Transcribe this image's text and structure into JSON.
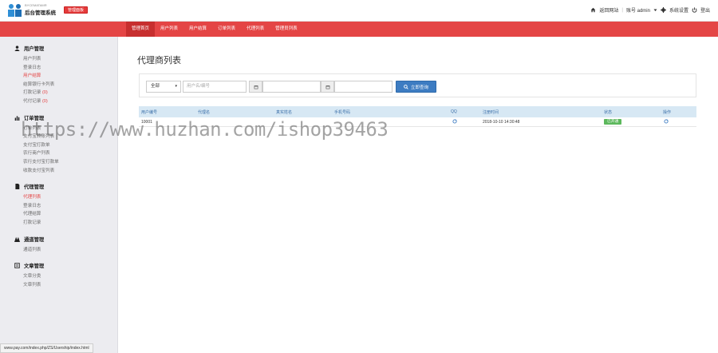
{
  "header": {
    "logo_small": "BYCEMATAMR",
    "logo_title": "后台管理系统",
    "badge": "管理面板",
    "home_link": "返回网站",
    "account_label": "账号 admin",
    "settings_label": "系统设置",
    "logout_label": "登出"
  },
  "nav": {
    "items": [
      {
        "label": "管理首页",
        "active": true
      },
      {
        "label": "用户列表",
        "active": false
      },
      {
        "label": "用户结算",
        "active": false
      },
      {
        "label": "订单列表",
        "active": false
      },
      {
        "label": "代理列表",
        "active": false
      },
      {
        "label": "管理员列表",
        "active": false
      }
    ]
  },
  "sidebar": {
    "groups": [
      {
        "icon": "user-icon",
        "title": "用户管理",
        "items": [
          {
            "label": "用户列表"
          },
          {
            "label": "登录日志"
          },
          {
            "label": "用户结算",
            "active": true
          },
          {
            "label": "结算银行卡列表"
          },
          {
            "label": "打款记录 ",
            "count": "(0)"
          },
          {
            "label": "代付记录 ",
            "count": "(0)"
          }
        ]
      },
      {
        "icon": "chart-icon",
        "title": "订单管理",
        "items": [
          {
            "label": "订单列表"
          },
          {
            "label": "支付宝转账列表"
          },
          {
            "label": "支付宝打款单"
          },
          {
            "label": "农行商户列表"
          },
          {
            "label": "农行支付宝打款单"
          },
          {
            "label": "收款支付宝列表"
          }
        ]
      },
      {
        "icon": "file-icon",
        "title": "代理管理",
        "items": [
          {
            "label": "代理列表",
            "active": true
          },
          {
            "label": "登录日志"
          },
          {
            "label": "代理结算"
          },
          {
            "label": "打款记录"
          }
        ]
      },
      {
        "icon": "channel-icon",
        "title": "通道管理",
        "items": [
          {
            "label": "通道列表"
          }
        ]
      },
      {
        "icon": "article-icon",
        "title": "文章管理",
        "items": [
          {
            "label": "文章分类"
          },
          {
            "label": "文章列表"
          }
        ]
      }
    ]
  },
  "page": {
    "title": "代理商列表"
  },
  "filter": {
    "select_value": "全部",
    "keyword_placeholder": "用户名/编号",
    "search_button": "立即查询"
  },
  "table": {
    "columns": [
      "用户编号",
      "代理名",
      "真实姓名",
      "手机号码",
      "QQ",
      "注册时间",
      "状态",
      "操作"
    ],
    "rows": [
      {
        "id": "10001",
        "agent_name": "",
        "real_name": "",
        "phone": "",
        "qq_icon": "edit-icon",
        "reg_time": "2018-10-10 14:30:48",
        "status": "已开通",
        "action_icon": "edit-icon"
      }
    ]
  },
  "watermark": "https://www.huzhan.com/ishop39463",
  "statusbar": {
    "url": "www.pay.com/index.php/ZS/Usership/index.html"
  },
  "colors": {
    "accent_red": "#e44545",
    "primary_blue": "#3d7cc2",
    "success_green": "#5cb85c",
    "table_head_bg": "#d7e8f4"
  }
}
